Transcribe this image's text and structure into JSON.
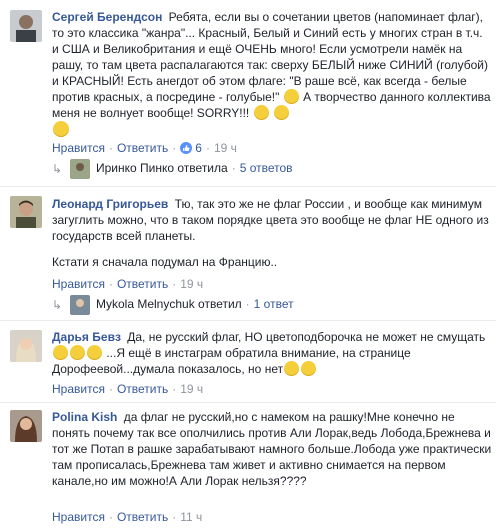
{
  "comments": [
    {
      "author": "Сергей Берендсон",
      "text": "Ребята, если вы о сочетании цветов (напоминает флаг), то это классика \"жанра\"... Красный, Белый и Синий есть у многих стран в т.ч. и США и Великобритания и ещё ОЧЕНЬ много! Если усмотрели намёк на рашу, то там цвета распалагаются так: сверху БЕЛЫЙ ниже СИНИЙ (голубой) и КРАСНЫЙ! Есть анегдот об этом флаге: \"В раше всё, как всегда - белые против красных, а посредине - голубые!\"",
      "text_tail": "А творчество данного коллектива меня не волнует вообще! SORRY!!!",
      "actions": {
        "like": "Нравится",
        "reply": "Ответить",
        "likes": "6",
        "time": "19 ч"
      },
      "replies": {
        "author": "Иринко Пинко",
        "verb": "ответила",
        "count": "5 ответов"
      }
    },
    {
      "author": "Леонард Григорьев",
      "text": "Тю, так это же не флаг России , и вообще как минимум загуглить можно, что в таком порядке цвета это вообще не флаг НЕ одного из государств всей планеты.",
      "text2": "Кстати я сначала подумал на Францию..",
      "actions": {
        "like": "Нравится",
        "reply": "Ответить",
        "time": "19 ч"
      },
      "replies": {
        "author": "Mykola Melnychuk",
        "verb": "ответил",
        "count": "1 ответ"
      }
    },
    {
      "author": "Дарья Бевз",
      "text_a": "Да, не русский флаг, НО цветоподборочка не может не смущать",
      "text_b": "...Я ещё в инстаграм обратила внимание, на странице Дорофеевой...думала показалось, но нет",
      "actions": {
        "like": "Нравится",
        "reply": "Ответить",
        "time": "19 ч"
      }
    },
    {
      "author": "Polina Kish",
      "text": "да флаг не русский,но с намеком на рашку!Мне конечно не понять почему так все ополчились против Али Лорак,ведь Лобода,Брежнева и тот же Потап в рашке зарабатывают намного больше.Лобода уже практически там прописалась,Брежнева там живет и активно снимается на первом канале,но им можно!А Али Лорак нельзя????",
      "actions": {
        "like": "Нравится",
        "reply": "Ответить",
        "time": "11 ч"
      }
    }
  ],
  "colors": {
    "link": "#365899",
    "meta": "#90949c",
    "text": "#1d2129",
    "like": "#5890ff"
  }
}
